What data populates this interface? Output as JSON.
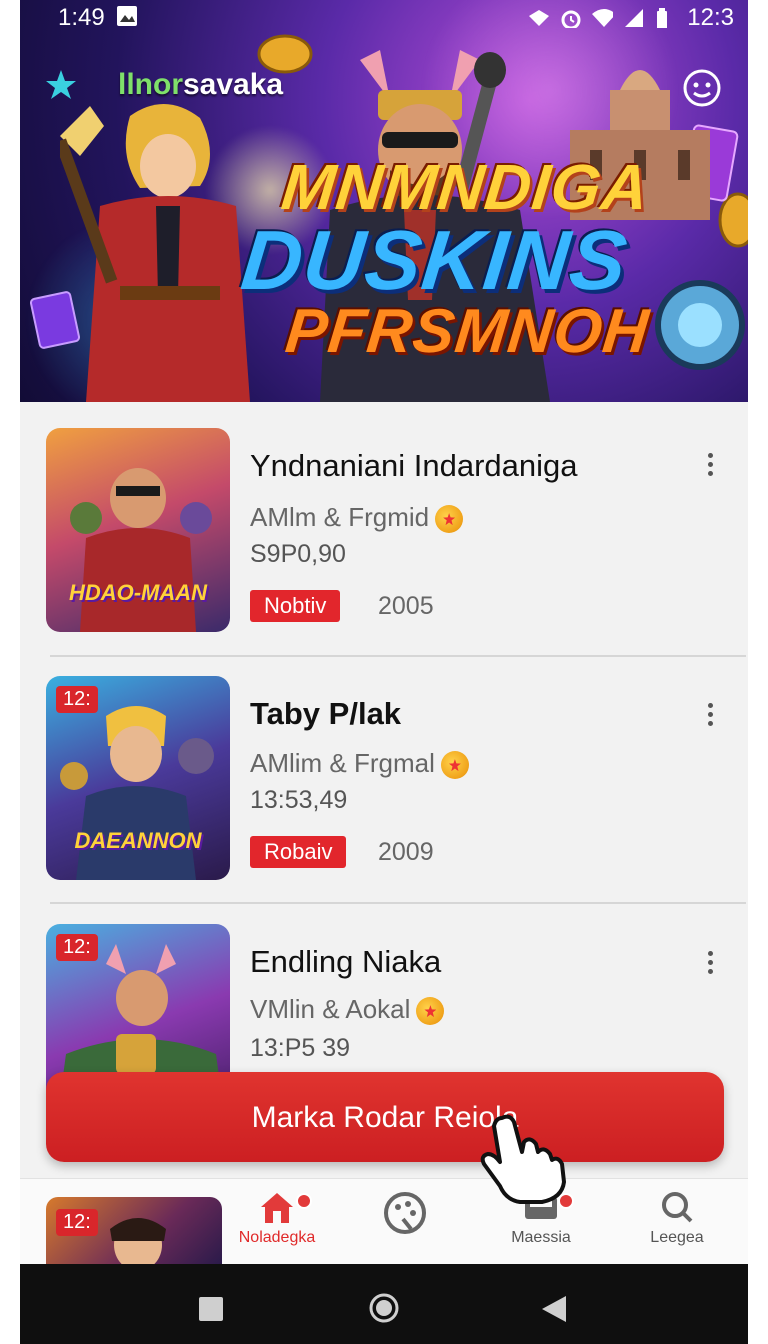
{
  "status_bar": {
    "time": "1:49",
    "battery_text": "12:3"
  },
  "hero": {
    "logo_green": "llnor",
    "logo_white": "savaka",
    "title_line1": "MNMNDIGA",
    "title_line2": "DUSKINS",
    "title_line3": "PFRSMNOH"
  },
  "items": [
    {
      "title": "Yndnaniani Indardaniga",
      "subtitle": "AMlm & Frgmid",
      "price": "S9P0,90",
      "tag": "Nobtiv",
      "year": "2005",
      "thumb_label": "HDAO-MAAN",
      "thumb_badge": ""
    },
    {
      "title": "Taby P/lak",
      "subtitle": "AMlim & Frgmal",
      "price": "13:53,49",
      "tag": "Robaiv",
      "year": "2009",
      "thumb_label": "DAEANNON",
      "thumb_badge": "12:"
    },
    {
      "title": "Endling Niaka",
      "subtitle": "VMlin & Aokal",
      "price": "13:P5 39",
      "tag": "",
      "year": "",
      "thumb_label": "",
      "thumb_badge": "12:"
    }
  ],
  "cta": {
    "label": "Marka Rodar Reiola"
  },
  "bottom_nav": {
    "mini_badge": "12:",
    "items": [
      {
        "label": "Noladegka",
        "icon": "home-icon",
        "active": true
      },
      {
        "label": "",
        "icon": "palette-icon",
        "active": false
      },
      {
        "label": "Maessia",
        "icon": "inbox-icon",
        "active": false
      },
      {
        "label": "Leegea",
        "icon": "search-icon",
        "active": false
      }
    ]
  },
  "colors": {
    "accent": "#e2262c",
    "hero_bg": "#3a1f8a",
    "nav_bg": "#0f0f0f"
  }
}
